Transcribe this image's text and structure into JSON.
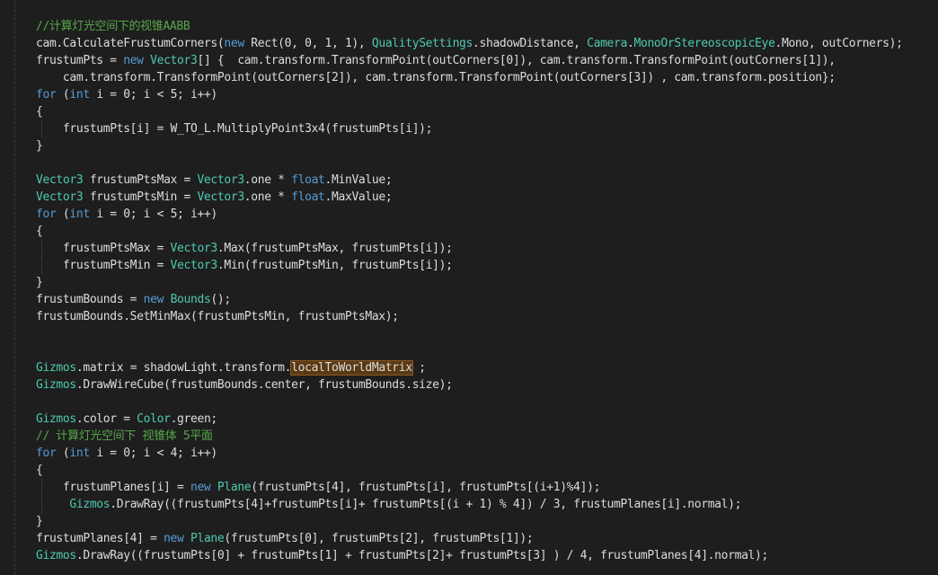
{
  "editor": {
    "language": "csharp",
    "theme": {
      "background": "#1e1e1e",
      "plain": "#dcdcdc",
      "keyword": "#569cd6",
      "type": "#4ec9b0",
      "comment": "#57a64a",
      "highlight": "#5a3a14"
    },
    "lines": [
      [
        {
          "t": "comment",
          "s": "//计算灯光空间下的视锥AABB"
        }
      ],
      [
        {
          "t": "plain",
          "s": "cam.CalculateFrustumCorners("
        },
        {
          "t": "keyword",
          "s": "new"
        },
        {
          "t": "plain",
          "s": " Rect(0, 0, 1, 1), "
        },
        {
          "t": "type",
          "s": "QualitySettings"
        },
        {
          "t": "plain",
          "s": ".shadowDistance, "
        },
        {
          "t": "type",
          "s": "Camera"
        },
        {
          "t": "plain",
          "s": "."
        },
        {
          "t": "type",
          "s": "MonoOrStereoscopicEye"
        },
        {
          "t": "plain",
          "s": ".Mono, outCorners);"
        }
      ],
      [
        {
          "t": "plain",
          "s": "frustumPts = "
        },
        {
          "t": "keyword",
          "s": "new"
        },
        {
          "t": "plain",
          "s": " "
        },
        {
          "t": "type",
          "s": "Vector3"
        },
        {
          "t": "plain",
          "s": "[] {  cam.transform.TransformPoint(outCorners[0]), cam.transform.TransformPoint(outCorners[1]),"
        }
      ],
      [
        {
          "t": "plain",
          "s": "    cam.transform.TransformPoint(outCorners[2]), cam.transform.TransformPoint(outCorners[3]) , cam.transform.position};"
        }
      ],
      [
        {
          "t": "keyword",
          "s": "for"
        },
        {
          "t": "plain",
          "s": " ("
        },
        {
          "t": "keyword",
          "s": "int"
        },
        {
          "t": "plain",
          "s": " i = 0; i < 5; i++)"
        }
      ],
      [
        {
          "t": "plain",
          "s": "{"
        }
      ],
      [
        {
          "t": "plain",
          "s": "    frustumPts[i] = W_TO_L.MultiplyPoint3x4(frustumPts[i]);"
        }
      ],
      [
        {
          "t": "plain",
          "s": "}"
        }
      ],
      [],
      [
        {
          "t": "type",
          "s": "Vector3"
        },
        {
          "t": "plain",
          "s": " frustumPtsMax = "
        },
        {
          "t": "type",
          "s": "Vector3"
        },
        {
          "t": "plain",
          "s": ".one * "
        },
        {
          "t": "keyword",
          "s": "float"
        },
        {
          "t": "plain",
          "s": ".MinValue;"
        }
      ],
      [
        {
          "t": "type",
          "s": "Vector3"
        },
        {
          "t": "plain",
          "s": " frustumPtsMin = "
        },
        {
          "t": "type",
          "s": "Vector3"
        },
        {
          "t": "plain",
          "s": ".one * "
        },
        {
          "t": "keyword",
          "s": "float"
        },
        {
          "t": "plain",
          "s": ".MaxValue;"
        }
      ],
      [
        {
          "t": "keyword",
          "s": "for"
        },
        {
          "t": "plain",
          "s": " ("
        },
        {
          "t": "keyword",
          "s": "int"
        },
        {
          "t": "plain",
          "s": " i = 0; i < 5; i++)"
        }
      ],
      [
        {
          "t": "plain",
          "s": "{"
        }
      ],
      [
        {
          "t": "plain",
          "s": "    frustumPtsMax = "
        },
        {
          "t": "type",
          "s": "Vector3"
        },
        {
          "t": "plain",
          "s": ".Max(frustumPtsMax, frustumPts[i]);"
        }
      ],
      [
        {
          "t": "plain",
          "s": "    frustumPtsMin = "
        },
        {
          "t": "type",
          "s": "Vector3"
        },
        {
          "t": "plain",
          "s": ".Min(frustumPtsMin, frustumPts[i]);"
        }
      ],
      [
        {
          "t": "plain",
          "s": "}"
        }
      ],
      [
        {
          "t": "plain",
          "s": "frustumBounds = "
        },
        {
          "t": "keyword",
          "s": "new"
        },
        {
          "t": "plain",
          "s": " "
        },
        {
          "t": "type",
          "s": "Bounds"
        },
        {
          "t": "plain",
          "s": "();"
        }
      ],
      [
        {
          "t": "plain",
          "s": "frustumBounds.SetMinMax(frustumPtsMin, frustumPtsMax);"
        }
      ],
      [],
      [],
      [
        {
          "t": "type",
          "s": "Gizmos"
        },
        {
          "t": "plain",
          "s": ".matrix = shadowLight.transform."
        },
        {
          "t": "highlight",
          "s": "localToWorldMatrix"
        },
        {
          "t": "plain",
          "s": " ;"
        }
      ],
      [
        {
          "t": "type",
          "s": "Gizmos"
        },
        {
          "t": "plain",
          "s": ".DrawWireCube(frustumBounds.center, frustumBounds.size);"
        }
      ],
      [],
      [
        {
          "t": "type",
          "s": "Gizmos"
        },
        {
          "t": "plain",
          "s": ".color = "
        },
        {
          "t": "type",
          "s": "Color"
        },
        {
          "t": "plain",
          "s": ".green;"
        }
      ],
      [
        {
          "t": "comment",
          "s": "// 计算灯光空间下 视锥体 5平面"
        }
      ],
      [
        {
          "t": "keyword",
          "s": "for"
        },
        {
          "t": "plain",
          "s": " ("
        },
        {
          "t": "keyword",
          "s": "int"
        },
        {
          "t": "plain",
          "s": " i = 0; i < 4; i++)"
        }
      ],
      [
        {
          "t": "plain",
          "s": "{"
        }
      ],
      [
        {
          "t": "plain",
          "s": "    frustumPlanes[i] = "
        },
        {
          "t": "keyword",
          "s": "new"
        },
        {
          "t": "plain",
          "s": " "
        },
        {
          "t": "type",
          "s": "Plane"
        },
        {
          "t": "plain",
          "s": "(frustumPts[4], frustumPts[i], frustumPts[(i+1)%4]);"
        }
      ],
      [
        {
          "t": "plain",
          "s": "     "
        },
        {
          "t": "type",
          "s": "Gizmos"
        },
        {
          "t": "plain",
          "s": ".DrawRay((frustumPts[4]+frustumPts[i]+ frustumPts[(i + 1) % 4]) / 3, frustumPlanes[i].normal);"
        }
      ],
      [
        {
          "t": "plain",
          "s": "}"
        }
      ],
      [
        {
          "t": "plain",
          "s": "frustumPlanes[4] = "
        },
        {
          "t": "keyword",
          "s": "new"
        },
        {
          "t": "plain",
          "s": " "
        },
        {
          "t": "type",
          "s": "Plane"
        },
        {
          "t": "plain",
          "s": "(frustumPts[0], frustumPts[2], frustumPts[1]);"
        }
      ],
      [
        {
          "t": "type",
          "s": "Gizmos"
        },
        {
          "t": "plain",
          "s": ".DrawRay((frustumPts[0] + frustumPts[1] + frustumPts[2]+ frustumPts[3] ) / 4, frustumPlanes[4].normal);"
        }
      ]
    ]
  }
}
